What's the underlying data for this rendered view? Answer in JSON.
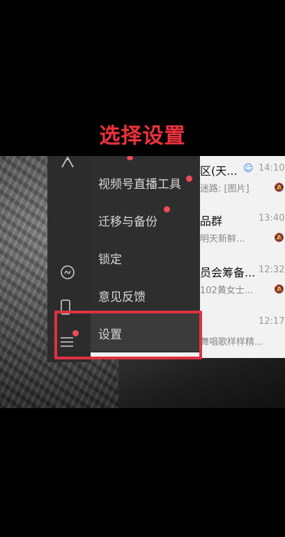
{
  "caption": "选择设置",
  "menu": {
    "items": [
      {
        "label": "视频号直播工具",
        "dot": true
      },
      {
        "label": "迁移与备份",
        "dot": true
      },
      {
        "label": "锁定",
        "dot": false
      },
      {
        "label": "意见反馈",
        "dot": false
      },
      {
        "label": "设置",
        "dot": false
      }
    ]
  },
  "chats": [
    {
      "title": "区(天...",
      "time": "14:10",
      "preview": "迷路: [图片]"
    },
    {
      "title": "品群",
      "time": "13:40",
      "preview": "明天新鲜..."
    },
    {
      "title": "员会筹备...",
      "time": "12:32",
      "preview": "102黄女士..."
    },
    {
      "title": "",
      "time": "12:17",
      "preview": "舞唱歌样样精..."
    }
  ],
  "icons": {
    "rail_top": "people-icon",
    "rail_mini": "mini-program-icon",
    "rail_phone": "phone-icon",
    "rail_menu": "menu-icon"
  },
  "colors": {
    "accent_red": "#e03141",
    "dot_red": "#f04b55"
  }
}
